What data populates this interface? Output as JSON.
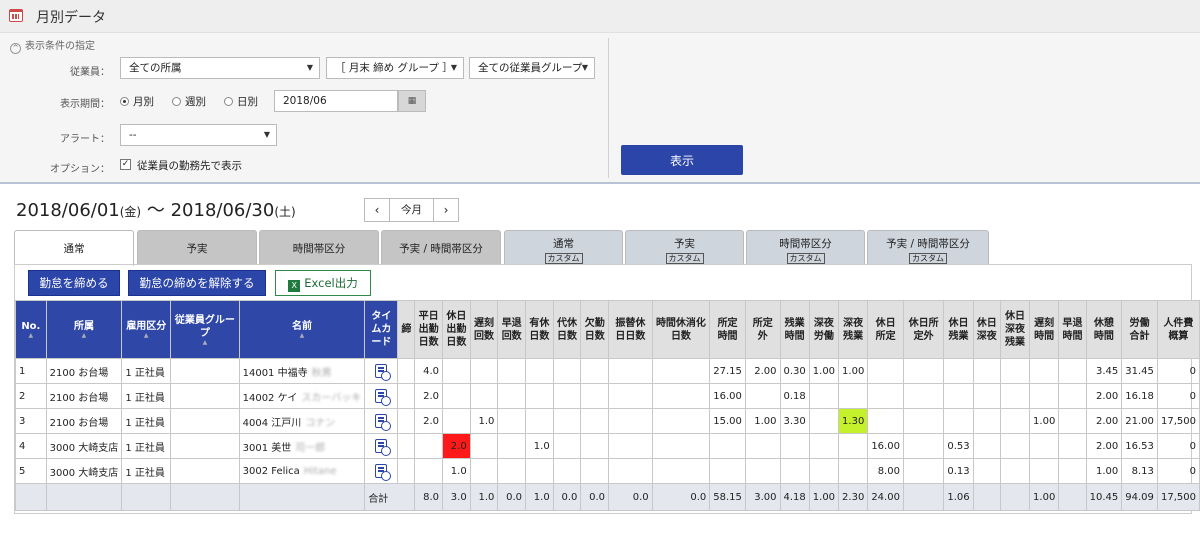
{
  "title": "月別データ",
  "conditions": {
    "header": "表示条件の指定",
    "employee_label": "従業員：",
    "employee_select1": "全ての所属",
    "employee_select2": "［ 月末 締め グループ ］",
    "employee_select3": "全ての従業員グループ",
    "period_label": "表示期間：",
    "period_options": [
      "月別",
      "週別",
      "日別"
    ],
    "period_selected": "月別",
    "period_value": "2018/06",
    "alert_label": "アラート：",
    "alert_value": "--",
    "option_label": "オプション：",
    "option_checkbox_label": "従業員の勤務先で表示",
    "option_checked": true,
    "show_button": "表示"
  },
  "range": {
    "start": "2018/06/01",
    "start_dow": "(金)",
    "sep": "〜",
    "end": "2018/06/30",
    "end_dow": "(土)",
    "prev": "‹",
    "current": "今月",
    "next": "›"
  },
  "tabs": [
    {
      "label": "通常",
      "sub": ""
    },
    {
      "label": "予実",
      "sub": ""
    },
    {
      "label": "時間帯区分",
      "sub": ""
    },
    {
      "label": "予実 / 時間帯区分",
      "sub": ""
    },
    {
      "label": "通常",
      "sub": "カスタム"
    },
    {
      "label": "予実",
      "sub": "カスタム"
    },
    {
      "label": "時間帯区分",
      "sub": "カスタム"
    },
    {
      "label": "予実 / 時間帯区分",
      "sub": "カスタム"
    }
  ],
  "actions": {
    "close": "勤怠を締める",
    "unclose": "勤怠の締めを解除する",
    "excel": "Excel出力"
  },
  "table": {
    "headers": [
      "No.",
      "所属",
      "雇用区分",
      "従業員グループ",
      "名前",
      "タイムカード",
      "締",
      "平日出勤日数",
      "休日出勤日数",
      "遅刻回数",
      "早退回数",
      "有休日数",
      "代休日数",
      "欠勤日数",
      "振替休日日数",
      "時間休消化日数",
      "所定時間",
      "所定外",
      "残業時間",
      "深夜労働",
      "深夜残業",
      "休日所定",
      "休日所定外",
      "休日残業",
      "休日深夜",
      "休日深夜残業",
      "遅刻時間",
      "早退時間",
      "休憩時間",
      "労働合計",
      "人件費概算"
    ],
    "rows": [
      {
        "no": "1",
        "dept": "2100 お台場",
        "emp": "1 正社員",
        "grp": "",
        "name": "14001 中福寺",
        "blur": "秋男",
        "v": [
          "4.0",
          "",
          "",
          "",
          "",
          "",
          "",
          "",
          "",
          "27.15",
          "2.00",
          "0.30",
          "1.00",
          "1.00",
          "",
          "",
          "",
          "",
          "",
          "",
          "",
          "3.45",
          "31.45",
          "0"
        ]
      },
      {
        "no": "2",
        "dept": "2100 お台場",
        "emp": "1 正社員",
        "grp": "",
        "name": "14002 ケイ",
        "blur": "スカーバッキ",
        "v": [
          "2.0",
          "",
          "",
          "",
          "",
          "",
          "",
          "",
          "",
          "16.00",
          "",
          "0.18",
          "",
          "",
          "",
          "",
          "",
          "",
          "",
          "",
          "",
          "2.00",
          "16.18",
          "0"
        ]
      },
      {
        "no": "3",
        "dept": "2100 お台場",
        "emp": "1 正社員",
        "grp": "",
        "name": "4004 江戸川",
        "blur": "コナン",
        "v": [
          "2.0",
          "",
          "1.0",
          "",
          "",
          "",
          "",
          "",
          "",
          "15.00",
          "1.00",
          "3.30",
          "",
          "1.30",
          "",
          "",
          "",
          "",
          "",
          "1.00",
          "",
          "2.00",
          "21.00",
          "17,500"
        ]
      },
      {
        "no": "4",
        "dept": "3000 大崎支店",
        "emp": "1 正社員",
        "grp": "",
        "name": "3001 美世",
        "blur": "司一郎",
        "v": [
          "",
          "2.0",
          "",
          "",
          "1.0",
          "",
          "",
          "",
          "",
          "",
          "",
          "",
          "",
          "",
          "16.00",
          "",
          "0.53",
          "",
          "",
          "",
          "",
          "2.00",
          "16.53",
          "0"
        ]
      },
      {
        "no": "5",
        "dept": "3000 大崎支店",
        "emp": "1 正社員",
        "grp": "",
        "name": "3002 Felica",
        "blur": "Hitane",
        "v": [
          "",
          "1.0",
          "",
          "",
          "",
          "",
          "",
          "",
          "",
          "",
          "",
          "",
          "",
          "",
          "8.00",
          "",
          "0.13",
          "",
          "",
          "",
          "",
          "1.00",
          "8.13",
          "0"
        ]
      }
    ],
    "total_label": "合計",
    "totals": [
      "8.0",
      "3.0",
      "1.0",
      "0.0",
      "1.0",
      "0.0",
      "0.0",
      "0.0",
      "0.0",
      "58.15",
      "3.00",
      "4.18",
      "1.00",
      "2.30",
      "24.00",
      "",
      "1.06",
      "",
      "",
      "1.00",
      "",
      "10.45",
      "94.09",
      "17,500"
    ],
    "highlight_colors": {
      "alert": "#ff1a1a",
      "warn": "#c5f02c"
    }
  }
}
